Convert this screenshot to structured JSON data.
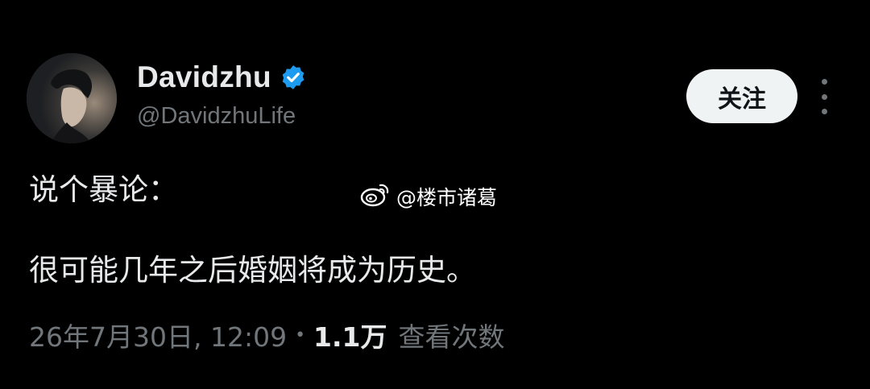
{
  "user": {
    "display_name": "Davidzhu",
    "handle": "@DavidzhuLife",
    "verified": true
  },
  "actions": {
    "follow_label": "关注"
  },
  "tweet": {
    "lines": [
      "说个暴论：",
      "很可能几年之后婚姻将成为历史。"
    ]
  },
  "watermark": {
    "text": "@楼市诸葛"
  },
  "meta": {
    "timestamp": "26年7月30日, 12:09",
    "separator": "•",
    "views_count": "1.1万",
    "views_label": "查看次数"
  },
  "colors": {
    "background": "#000000",
    "primary_text": "#e7e9ea",
    "secondary_text": "#71767b",
    "verified_badge": "#1d9bf0",
    "follow_button_bg": "#eff3f4"
  },
  "icons": {
    "verified": "verified-badge-icon",
    "more": "more-vertical-icon",
    "watermark": "weibo-icon"
  }
}
